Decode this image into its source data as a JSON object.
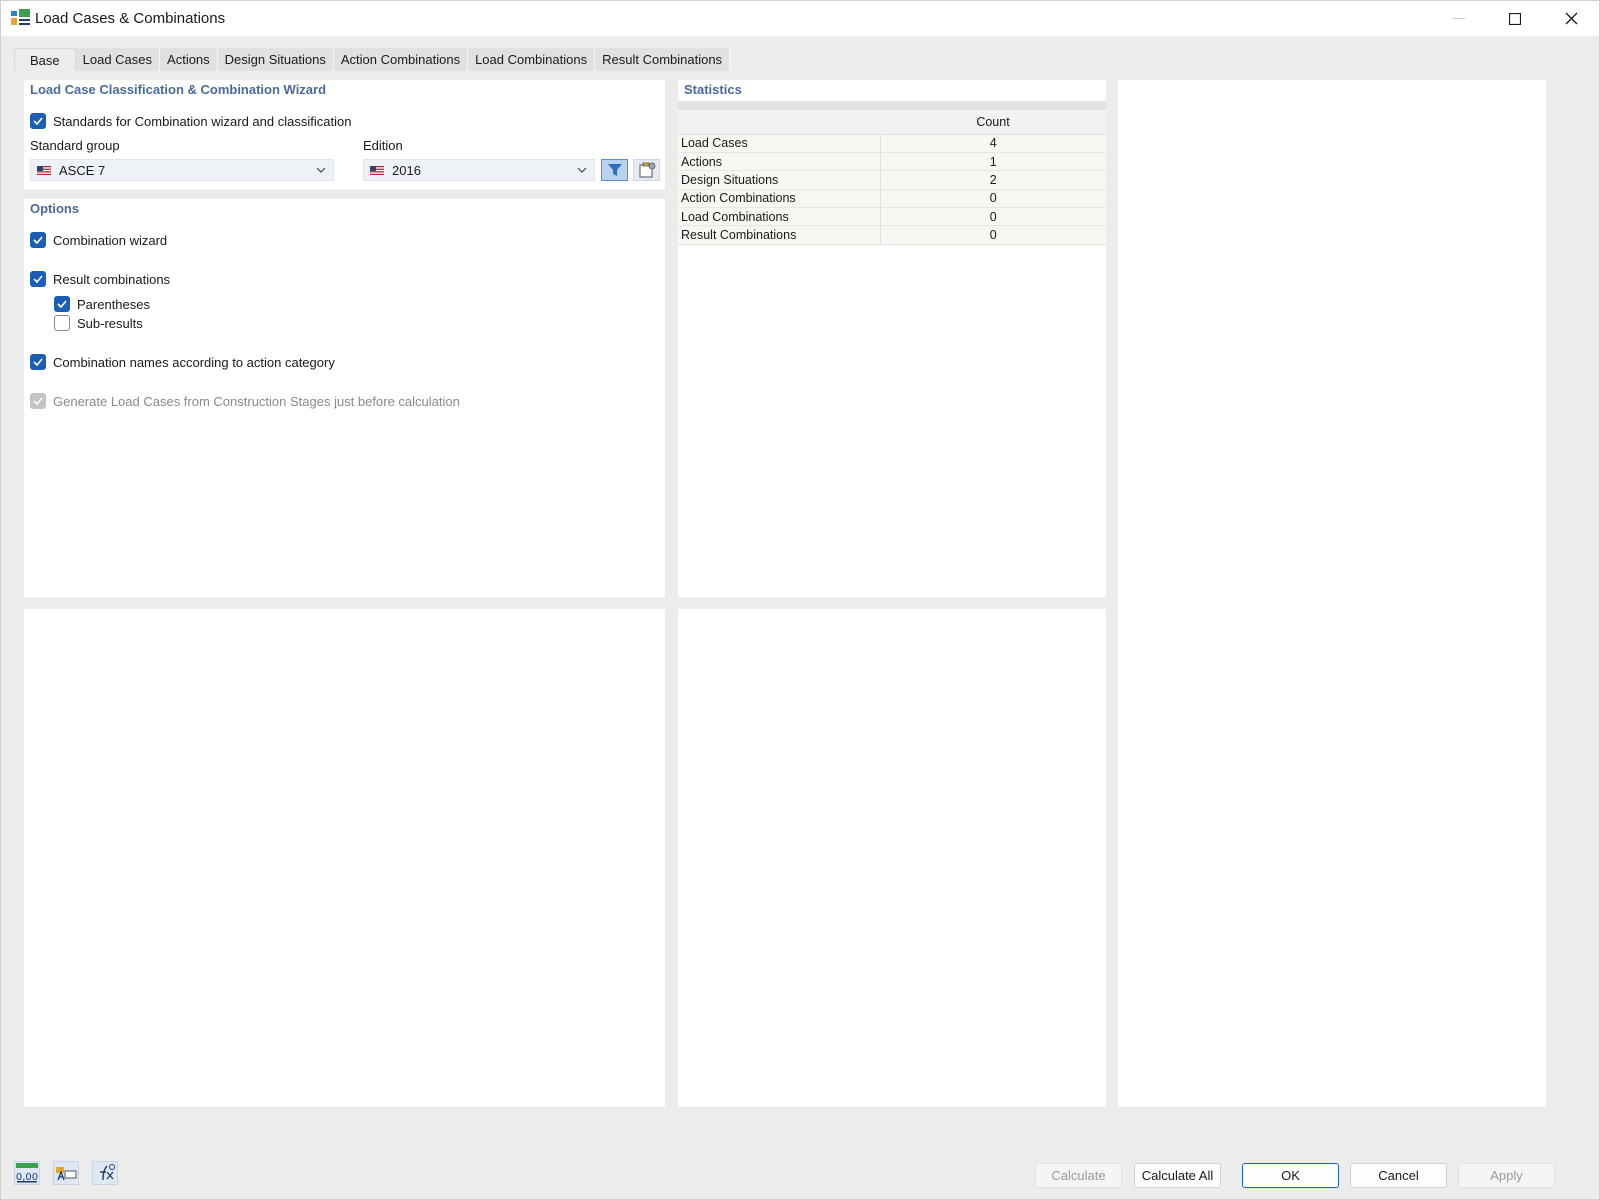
{
  "window": {
    "title": "Load Cases & Combinations"
  },
  "tabs": [
    {
      "label": "Base"
    },
    {
      "label": "Load Cases"
    },
    {
      "label": "Actions"
    },
    {
      "label": "Design Situations"
    },
    {
      "label": "Action Combinations"
    },
    {
      "label": "Load Combinations"
    },
    {
      "label": "Result Combinations"
    }
  ],
  "classification": {
    "title": "Load Case Classification & Combination Wizard",
    "standards_label": "Standards for Combination wizard and classification",
    "standards_checked": true,
    "standard_group_label": "Standard group",
    "standard_group_value": "ASCE 7",
    "edition_label": "Edition",
    "edition_value": "2016"
  },
  "options": {
    "title": "Options",
    "combination_wizard": "Combination wizard",
    "result_combinations": "Result combinations",
    "parentheses": "Parentheses",
    "sub_results": "Sub-results",
    "combination_names": "Combination names according to action category",
    "generate_load_cases": "Generate Load Cases from Construction Stages just before calculation"
  },
  "statistics": {
    "title": "Statistics",
    "column_header": "Count",
    "rows": [
      {
        "name": "Load Cases",
        "count": "4"
      },
      {
        "name": "Actions",
        "count": "1"
      },
      {
        "name": "Design Situations",
        "count": "2"
      },
      {
        "name": "Action Combinations",
        "count": "0"
      },
      {
        "name": "Load Combinations",
        "count": "0"
      },
      {
        "name": "Result Combinations",
        "count": "0"
      }
    ]
  },
  "toolbar": {
    "units_label": "0,00"
  },
  "buttons": {
    "calculate": "Calculate",
    "calculate_all": "Calculate All",
    "ok": "OK",
    "cancel": "Cancel",
    "apply": "Apply"
  },
  "colors": {
    "accent": "#1a5fb4",
    "section_title": "#4a6a9b"
  }
}
